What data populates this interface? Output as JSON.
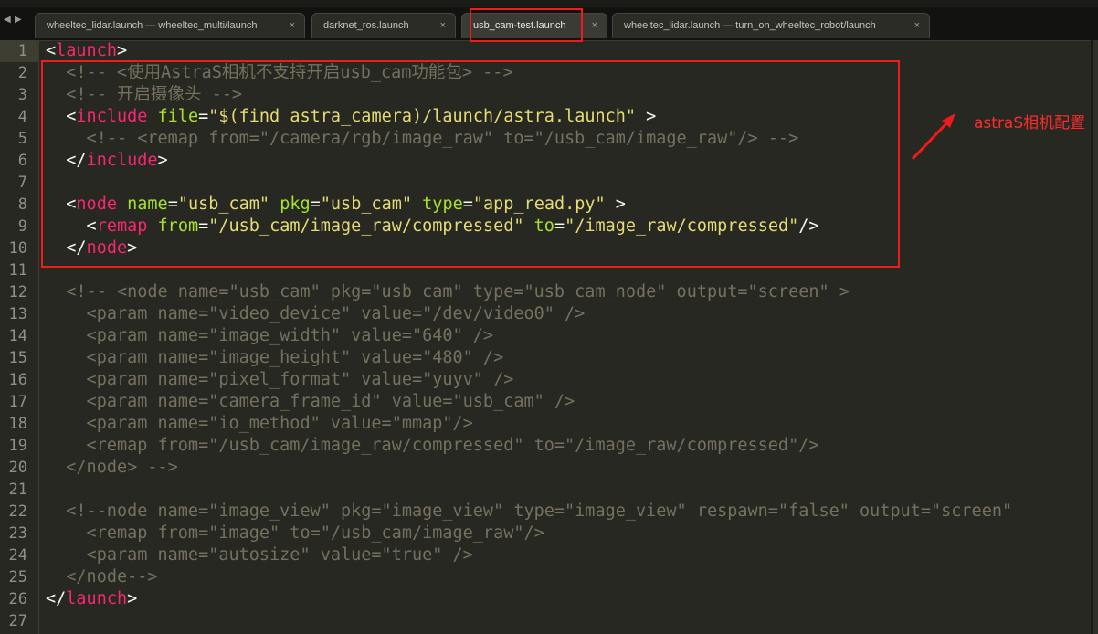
{
  "tabs": [
    {
      "label": "wheeltec_lidar.launch — wheeltec_multi/launch",
      "close": "×",
      "active": false
    },
    {
      "label": "darknet_ros.launch",
      "close": "×",
      "active": false
    },
    {
      "label": "usb_cam-test.launch",
      "close": "×",
      "active": true
    },
    {
      "label": "wheeltec_lidar.launch — turn_on_wheeltec_robot/launch",
      "close": "×",
      "active": false
    }
  ],
  "nav": {
    "prev": "◀",
    "next": "▶"
  },
  "annotation": {
    "text": "astraS相机配置",
    "color": "#ff2a2a"
  },
  "colors": {
    "background": "#272822",
    "tag": "#f92672",
    "attribute": "#a6e22e",
    "string": "#e6db74",
    "comment": "#75715e",
    "highlight_box": "#f01b1b"
  },
  "code": {
    "lines": [
      {
        "n": "1",
        "tokens": [
          [
            "g",
            "<"
          ],
          [
            "t",
            "launch"
          ],
          [
            "g",
            ">"
          ]
        ]
      },
      {
        "n": "2",
        "tokens": [
          [
            "c",
            "  <!-- <使用AstraS相机不支持开启usb_cam功能包> -->"
          ]
        ]
      },
      {
        "n": "3",
        "tokens": [
          [
            "c",
            "  <!-- 开启摄像头 -->"
          ]
        ]
      },
      {
        "n": "4",
        "tokens": [
          [
            "g",
            "  <"
          ],
          [
            "t",
            "include"
          ],
          [
            "g",
            " "
          ],
          [
            "a",
            "file"
          ],
          [
            "g",
            "="
          ],
          [
            "s",
            "\"$(find astra_camera)/launch/astra.launch\""
          ],
          [
            "g",
            " >"
          ]
        ]
      },
      {
        "n": "5",
        "tokens": [
          [
            "c",
            "    <!-- <remap from=\"/camera/rgb/image_raw\" to=\"/usb_cam/image_raw\"/> -->"
          ]
        ]
      },
      {
        "n": "6",
        "tokens": [
          [
            "g",
            "  </"
          ],
          [
            "t",
            "include"
          ],
          [
            "g",
            ">"
          ]
        ]
      },
      {
        "n": "7",
        "tokens": []
      },
      {
        "n": "8",
        "tokens": [
          [
            "g",
            "  <"
          ],
          [
            "t",
            "node"
          ],
          [
            "g",
            " "
          ],
          [
            "a",
            "name"
          ],
          [
            "g",
            "="
          ],
          [
            "s",
            "\"usb_cam\""
          ],
          [
            "g",
            " "
          ],
          [
            "a",
            "pkg"
          ],
          [
            "g",
            "="
          ],
          [
            "s",
            "\"usb_cam\""
          ],
          [
            "g",
            " "
          ],
          [
            "a",
            "type"
          ],
          [
            "g",
            "="
          ],
          [
            "s",
            "\"app_read.py\""
          ],
          [
            "g",
            " >"
          ]
        ]
      },
      {
        "n": "9",
        "tokens": [
          [
            "g",
            "    <"
          ],
          [
            "t",
            "remap"
          ],
          [
            "g",
            " "
          ],
          [
            "a",
            "from"
          ],
          [
            "g",
            "="
          ],
          [
            "s",
            "\"/usb_cam/image_raw/compressed\""
          ],
          [
            "g",
            " "
          ],
          [
            "a",
            "to"
          ],
          [
            "g",
            "="
          ],
          [
            "s",
            "\"/image_raw/compressed\""
          ],
          [
            "g",
            "/>"
          ]
        ]
      },
      {
        "n": "10",
        "tokens": [
          [
            "g",
            "  </"
          ],
          [
            "t",
            "node"
          ],
          [
            "g",
            ">"
          ]
        ]
      },
      {
        "n": "11",
        "tokens": []
      },
      {
        "n": "12",
        "tokens": [
          [
            "c",
            "  <!-- <node name=\"usb_cam\" pkg=\"usb_cam\" type=\"usb_cam_node\" output=\"screen\" >"
          ]
        ]
      },
      {
        "n": "13",
        "tokens": [
          [
            "c",
            "    <param name=\"video_device\" value=\"/dev/video0\" />"
          ]
        ]
      },
      {
        "n": "14",
        "tokens": [
          [
            "c",
            "    <param name=\"image_width\" value=\"640\" />"
          ]
        ]
      },
      {
        "n": "15",
        "tokens": [
          [
            "c",
            "    <param name=\"image_height\" value=\"480\" />"
          ]
        ]
      },
      {
        "n": "16",
        "tokens": [
          [
            "c",
            "    <param name=\"pixel_format\" value=\"yuyv\" />"
          ]
        ]
      },
      {
        "n": "17",
        "tokens": [
          [
            "c",
            "    <param name=\"camera_frame_id\" value=\"usb_cam\" />"
          ]
        ]
      },
      {
        "n": "18",
        "tokens": [
          [
            "c",
            "    <param name=\"io_method\" value=\"mmap\"/>"
          ]
        ]
      },
      {
        "n": "19",
        "tokens": [
          [
            "c",
            "    <remap from=\"/usb_cam/image_raw/compressed\" to=\"/image_raw/compressed\"/>"
          ]
        ]
      },
      {
        "n": "20",
        "tokens": [
          [
            "c",
            "  </node> -->"
          ]
        ]
      },
      {
        "n": "21",
        "tokens": []
      },
      {
        "n": "22",
        "tokens": [
          [
            "c",
            "  <!--node name=\"image_view\" pkg=\"image_view\" type=\"image_view\" respawn=\"false\" output=\"screen\""
          ]
        ]
      },
      {
        "n": "23",
        "tokens": [
          [
            "c",
            "    <remap from=\"image\" to=\"/usb_cam/image_raw\"/>"
          ]
        ]
      },
      {
        "n": "24",
        "tokens": [
          [
            "c",
            "    <param name=\"autosize\" value=\"true\" />"
          ]
        ]
      },
      {
        "n": "25",
        "tokens": [
          [
            "c",
            "  </node-->"
          ]
        ]
      },
      {
        "n": "26",
        "tokens": [
          [
            "g",
            "</"
          ],
          [
            "t",
            "launch"
          ],
          [
            "g",
            ">"
          ]
        ]
      },
      {
        "n": "27",
        "tokens": []
      }
    ]
  }
}
